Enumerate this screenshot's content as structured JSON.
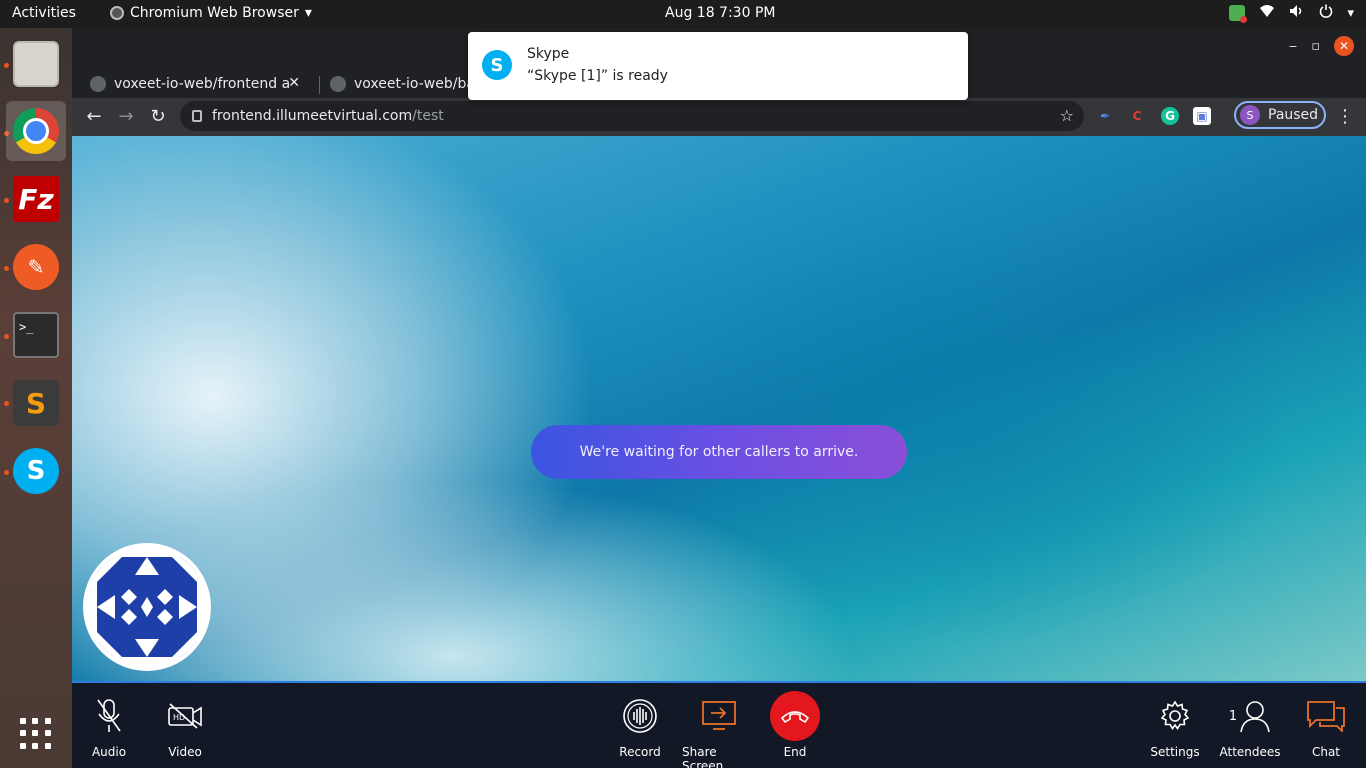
{
  "topbar": {
    "activities": "Activities",
    "app_name": "Chromium Web Browser",
    "clock": "Aug 18  7:30 PM"
  },
  "dock": {
    "items": [
      {
        "name": "files"
      },
      {
        "name": "chromium"
      },
      {
        "name": "filezilla",
        "glyph": "Fz"
      },
      {
        "name": "postman",
        "glyph": "✎"
      },
      {
        "name": "terminal",
        "glyph": ">_"
      },
      {
        "name": "sublime-text",
        "glyph": "S"
      },
      {
        "name": "skype",
        "glyph": "S"
      }
    ]
  },
  "browser": {
    "tabs": [
      {
        "title": "voxeet-io-web/frontend a"
      },
      {
        "title": "voxeet-io-web/ba"
      }
    ],
    "url_host": "frontend.illumeetvirtual.com",
    "url_path": "/test",
    "profile_initial": "S",
    "profile_label": "Paused",
    "extensions": [
      {
        "name": "pen-extension",
        "glyph": "✒",
        "color": "#4a8ef0"
      },
      {
        "name": "c-extension",
        "glyph": "C",
        "color": "#e53935"
      },
      {
        "name": "grammarly-extension",
        "glyph": "G",
        "color": "#15c39a"
      },
      {
        "name": "screen-extension",
        "glyph": "▣",
        "color": "#5b7bd5"
      }
    ]
  },
  "call": {
    "waiting_message": "We're waiting for other callers to arrive.",
    "controls": {
      "audio": "Audio",
      "video": "Video",
      "record": "Record",
      "share_screen": "Share Screen",
      "end": "End",
      "settings": "Settings",
      "attendees": "Attendees",
      "attendees_count": "1",
      "chat": "Chat"
    },
    "accent_color": "#e8702a",
    "end_color": "#e3171d"
  },
  "notification": {
    "title": "Skype",
    "body": "“Skype [1]” is ready"
  }
}
